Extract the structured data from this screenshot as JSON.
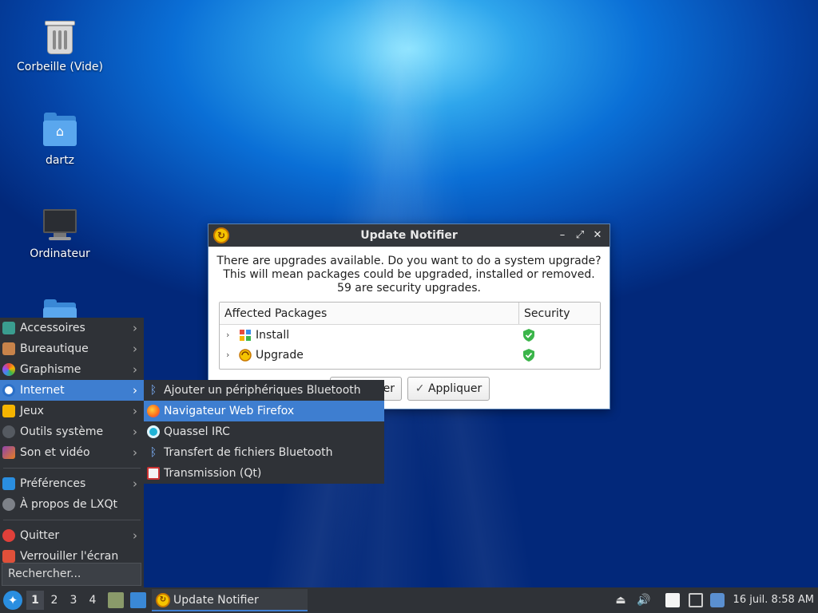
{
  "desktop": {
    "icons": [
      {
        "label": "Corbeille (Vide)"
      },
      {
        "label": "dartz"
      },
      {
        "label": "Ordinateur"
      }
    ]
  },
  "dialog": {
    "title": "Update Notifier",
    "message_line1": "There are upgrades available. Do you want to do a system upgrade?",
    "message_line2": "This will mean packages could be upgraded, installed or removed.",
    "message_line3": "59 are security upgrades.",
    "col_packages": "Affected Packages",
    "col_security": "Security",
    "rows": [
      {
        "label": "Install",
        "icon": "package-install-icon"
      },
      {
        "label": "Upgrade",
        "icon": "package-upgrade-icon"
      }
    ],
    "cancel_label": "er",
    "apply_label": "Appliquer",
    "titlebar_buttons": {
      "minimize": "–",
      "maximize": "⤢",
      "close": "✕"
    }
  },
  "start_menu": {
    "items": [
      {
        "label": "Accessoires",
        "arrow": "›"
      },
      {
        "label": "Bureautique",
        "arrow": "›"
      },
      {
        "label": "Graphisme",
        "arrow": "›"
      },
      {
        "label": "Internet",
        "arrow": "›"
      },
      {
        "label": "Jeux",
        "arrow": "›"
      },
      {
        "label": "Outils système",
        "arrow": "›"
      },
      {
        "label": "Son et vidéo",
        "arrow": "›"
      },
      {
        "label": "Préférences",
        "arrow": "›"
      },
      {
        "label": "À propos de LXQt"
      },
      {
        "label": "Quitter",
        "arrow": "›"
      },
      {
        "label": "Verrouiller l'écran"
      }
    ],
    "search_placeholder": "Rechercher..."
  },
  "internet_submenu": {
    "items": [
      {
        "label": "Ajouter un périphériques Bluetooth"
      },
      {
        "label": "Navigateur Web Firefox"
      },
      {
        "label": "Quassel IRC"
      },
      {
        "label": "Transfert de fichiers Bluetooth"
      },
      {
        "label": "Transmission (Qt)"
      }
    ]
  },
  "taskbar": {
    "workspaces": [
      "1",
      "2",
      "3",
      "4"
    ],
    "task_label": "Update Notifier",
    "clock": "16 juil. 8:58 AM"
  },
  "colors": {
    "accent": "#3e7ed0",
    "panel": "#2f3237",
    "shield": "#3bb54a"
  }
}
